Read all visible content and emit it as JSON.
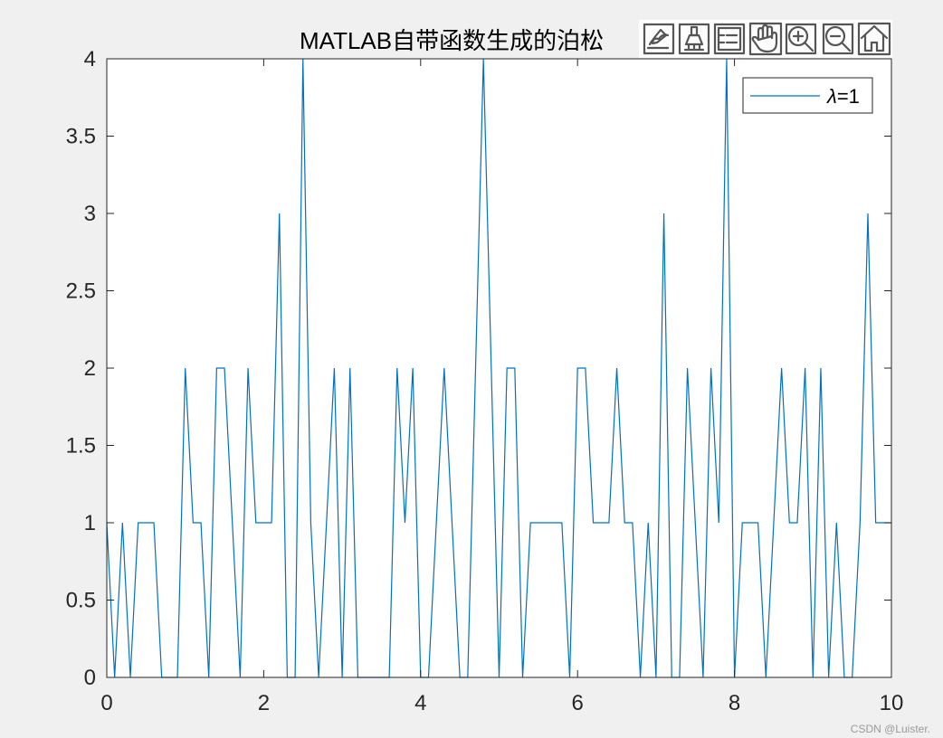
{
  "figure": {
    "watermark": "CSDN @Luister.",
    "toolbar": [
      {
        "name": "brush-data-icon",
        "tooltip": ""
      },
      {
        "name": "data-tips-icon",
        "tooltip": ""
      },
      {
        "name": "restore-legend-icon",
        "tooltip": ""
      },
      {
        "name": "pan-hand-icon",
        "tooltip": ""
      },
      {
        "name": "zoom-in-icon",
        "tooltip": ""
      },
      {
        "name": "zoom-out-icon",
        "tooltip": ""
      },
      {
        "name": "home-icon",
        "tooltip": ""
      }
    ]
  },
  "colors": {
    "figure_bg": "#f0f0f0",
    "axes_bg": "#ffffff",
    "series": "#0072bd",
    "axis": "#262626"
  },
  "chart_data": {
    "type": "line",
    "title": "MATLAB自带函数生成的泊松",
    "xlabel": "",
    "ylabel": "",
    "xlim": [
      0,
      10
    ],
    "ylim": [
      0,
      4
    ],
    "xticks": [
      0,
      2,
      4,
      6,
      8,
      10
    ],
    "xtick_labels": [
      "0",
      "2",
      "4",
      "6",
      "8",
      "10"
    ],
    "yticks": [
      0,
      0.5,
      1,
      1.5,
      2,
      2.5,
      3,
      3.5,
      4
    ],
    "ytick_labels": [
      "0",
      "0.5",
      "1",
      "1.5",
      "2",
      "2.5",
      "3",
      "3.5",
      "4"
    ],
    "grid": false,
    "box": true,
    "legend_position": "top-right",
    "legend_label_prefix": "λ",
    "legend_label_suffix": "=1",
    "series": [
      {
        "name": "λ=1",
        "x": [
          0,
          0.1,
          0.2,
          0.3,
          0.4,
          0.5,
          0.6,
          0.7,
          0.8,
          0.9,
          1.0,
          1.1,
          1.2,
          1.3,
          1.4,
          1.5,
          1.6,
          1.7,
          1.8,
          1.9,
          2.0,
          2.1,
          2.2,
          2.3,
          2.4,
          2.5,
          2.6,
          2.7,
          2.8,
          2.9,
          3.0,
          3.1,
          3.2,
          3.3,
          3.4,
          3.5,
          3.6,
          3.7,
          3.8,
          3.9,
          4.0,
          4.1,
          4.2,
          4.3,
          4.4,
          4.5,
          4.6,
          4.7,
          4.8,
          4.9,
          5.0,
          5.1,
          5.2,
          5.3,
          5.4,
          5.5,
          5.6,
          5.7,
          5.8,
          5.9,
          6.0,
          6.1,
          6.2,
          6.3,
          6.4,
          6.5,
          6.6,
          6.7,
          6.8,
          6.9,
          7.0,
          7.1,
          7.2,
          7.3,
          7.4,
          7.5,
          7.6,
          7.7,
          7.8,
          7.9,
          8.0,
          8.1,
          8.2,
          8.3,
          8.4,
          8.5,
          8.6,
          8.7,
          8.8,
          8.9,
          9.0,
          9.1,
          9.2,
          9.3,
          9.4,
          9.5,
          9.6,
          9.7,
          9.8,
          9.9,
          10.0
        ],
        "y": [
          1,
          0,
          1,
          0,
          1,
          1,
          1,
          0,
          0,
          0,
          2,
          1,
          1,
          0,
          2,
          2,
          1,
          0,
          2,
          1,
          1,
          1,
          3,
          0,
          0,
          4,
          1,
          0,
          1,
          2,
          0,
          2,
          0,
          0,
          0,
          0,
          0,
          2,
          1,
          2,
          0,
          0,
          1,
          2,
          1,
          0,
          0,
          2,
          4,
          2,
          0,
          2,
          2,
          0,
          1,
          1,
          1,
          1,
          1,
          0,
          2,
          2,
          1,
          1,
          1,
          2,
          1,
          1,
          0,
          1,
          0,
          3,
          0,
          0,
          2,
          1,
          0,
          2,
          1,
          4,
          0,
          1,
          1,
          1,
          0,
          1,
          2,
          1,
          1,
          2,
          0,
          2,
          0,
          1,
          0,
          0,
          1,
          3,
          1,
          1,
          1
        ]
      }
    ]
  }
}
